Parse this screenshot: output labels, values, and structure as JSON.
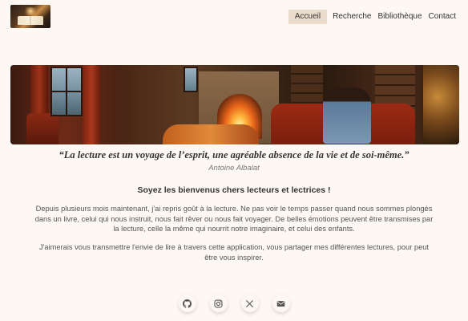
{
  "nav": {
    "items": [
      {
        "label": "Accueil",
        "active": true
      },
      {
        "label": "Recherche",
        "active": false
      },
      {
        "label": "Bibliothèque",
        "active": false
      },
      {
        "label": "Contact",
        "active": false
      }
    ]
  },
  "quote": {
    "text": "“La lecture est un voyage de l’esprit, une agréable absence de la vie et de soi-même.”",
    "author": "Antoine Albalat"
  },
  "main": {
    "welcome": "Soyez les bienvenus chers lecteurs et lectrices !",
    "paragraph1": "Depuis plusieurs mois maintenant, j'ai repris goût à la lecture. Ne pas voir le temps passer quand nous sommes plongés dans un livre, celui qui nous instruit, nous fait rêver ou nous fait voyager. De belles émotions peuvent être transmises par la lecture, celle la même qui nourrit notre imaginaire, et celui des enfants.",
    "paragraph2": "J'aimerais vous transmettre l'envie de lire à travers cette application, vous partager mes différentes lectures, pour peut être vous inspirer."
  },
  "footer": {
    "icons": [
      "github-icon",
      "instagram-icon",
      "x-twitter-icon",
      "envelope-icon"
    ]
  },
  "colors": {
    "background": "#fdf8f4",
    "nav_active": "#ecdccb"
  }
}
